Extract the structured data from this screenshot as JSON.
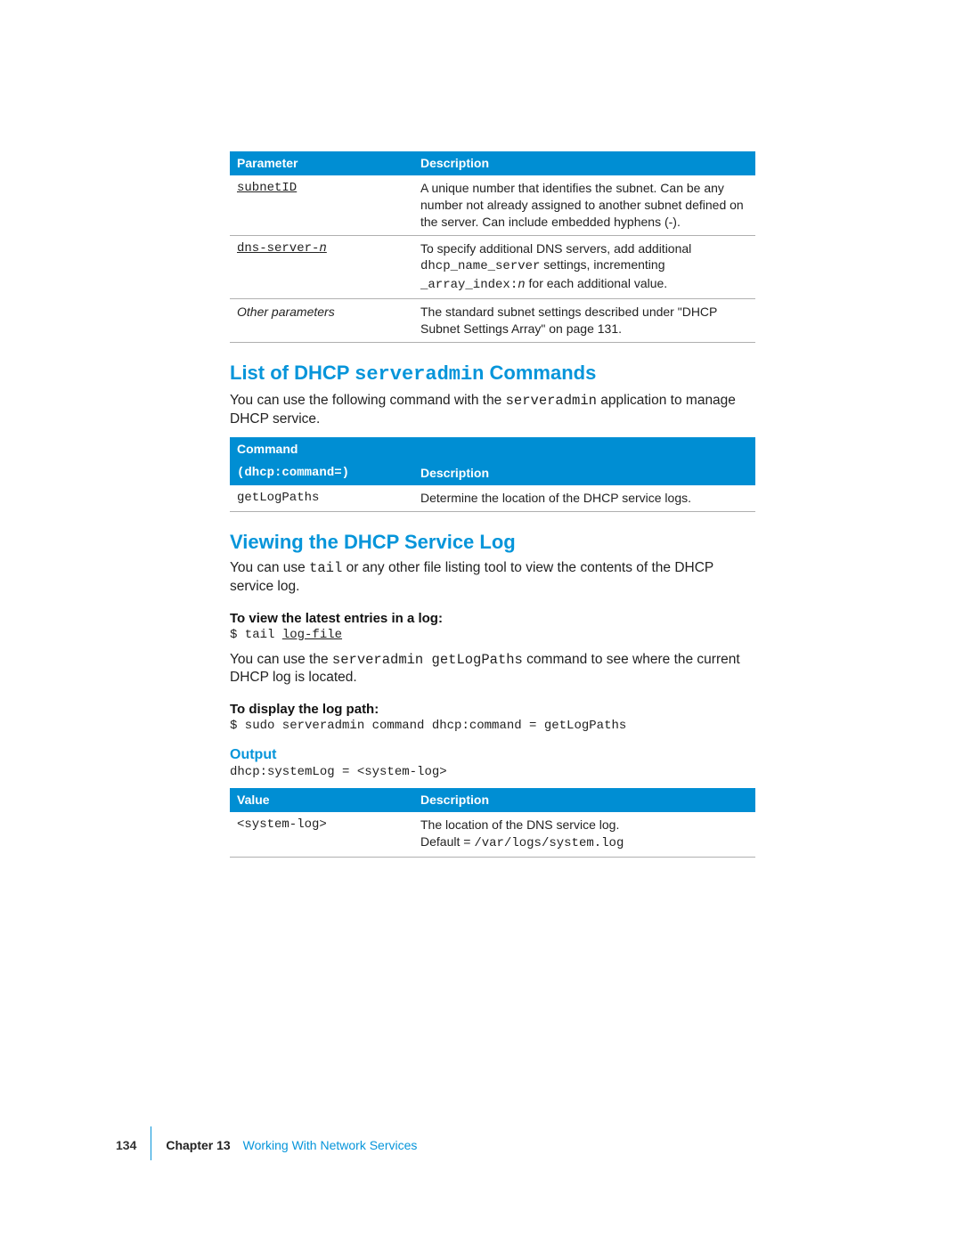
{
  "table1": {
    "headers": {
      "c1": "Parameter",
      "c2": "Description"
    },
    "rows": [
      {
        "param": "subnetID",
        "desc": "A unique number that identifies the subnet. Can be any number not already assigned to another subnet defined on the server. Can include embedded hyphens (-)."
      },
      {
        "param_html": true,
        "param_prefix": "dns-server-",
        "param_suffix": "n",
        "desc_line1": "To specify additional DNS servers, add additional",
        "desc_code1": "dhcp_name_server",
        "desc_line1b": " settings, incrementing",
        "desc_code2": "_array_index:",
        "desc_code2_italic": "n",
        "desc_line2": " for each additional value."
      },
      {
        "param_italic": "Other parameters",
        "desc": "The standard subnet settings described under \"DHCP Subnet Settings Array\" on page 131."
      }
    ]
  },
  "heading1_pre": "List of DHCP ",
  "heading1_code": "serveradmin",
  "heading1_post": " Commands",
  "para1_pre": "You can use the following command with the ",
  "para1_code": "serveradmin",
  "para1_post": " application to manage DHCP service.",
  "table2": {
    "header_top": "Command",
    "header_bottom_left": "(dhcp:command=)",
    "header_bottom_right": "Description",
    "row": {
      "cmd": "getLogPaths",
      "desc": "Determine the location of the DHCP service logs."
    }
  },
  "heading2": "Viewing the DHCP Service Log",
  "para2_pre": "You can use ",
  "para2_code": "tail",
  "para2_post": " or any other file listing tool to view the contents of the DHCP service log.",
  "sub1": "To view the latest entries in a log:",
  "code1_pre": "$ tail ",
  "code1_under": "log-file",
  "para3_pre": "You can use the ",
  "para3_code": "serveradmin getLogPaths",
  "para3_post": " command to see where the current DHCP log is located.",
  "sub2": "To display the log path:",
  "code2": "$ sudo serveradmin command dhcp:command = getLogPaths",
  "output_heading": "Output",
  "code3_pre": "dhcp:systemLog = ",
  "code3_tag": "<system-log>",
  "table3": {
    "headers": {
      "c1": "Value",
      "c2": "Description"
    },
    "row": {
      "value": "<system-log>",
      "desc_line1": "The location of the DNS service log.",
      "desc_line2_pre": "Default = ",
      "desc_line2_code": "/var/logs/system.log"
    }
  },
  "footer": {
    "page": "134",
    "chapter_label": "Chapter 13",
    "chapter_title": "Working With Network Services"
  }
}
